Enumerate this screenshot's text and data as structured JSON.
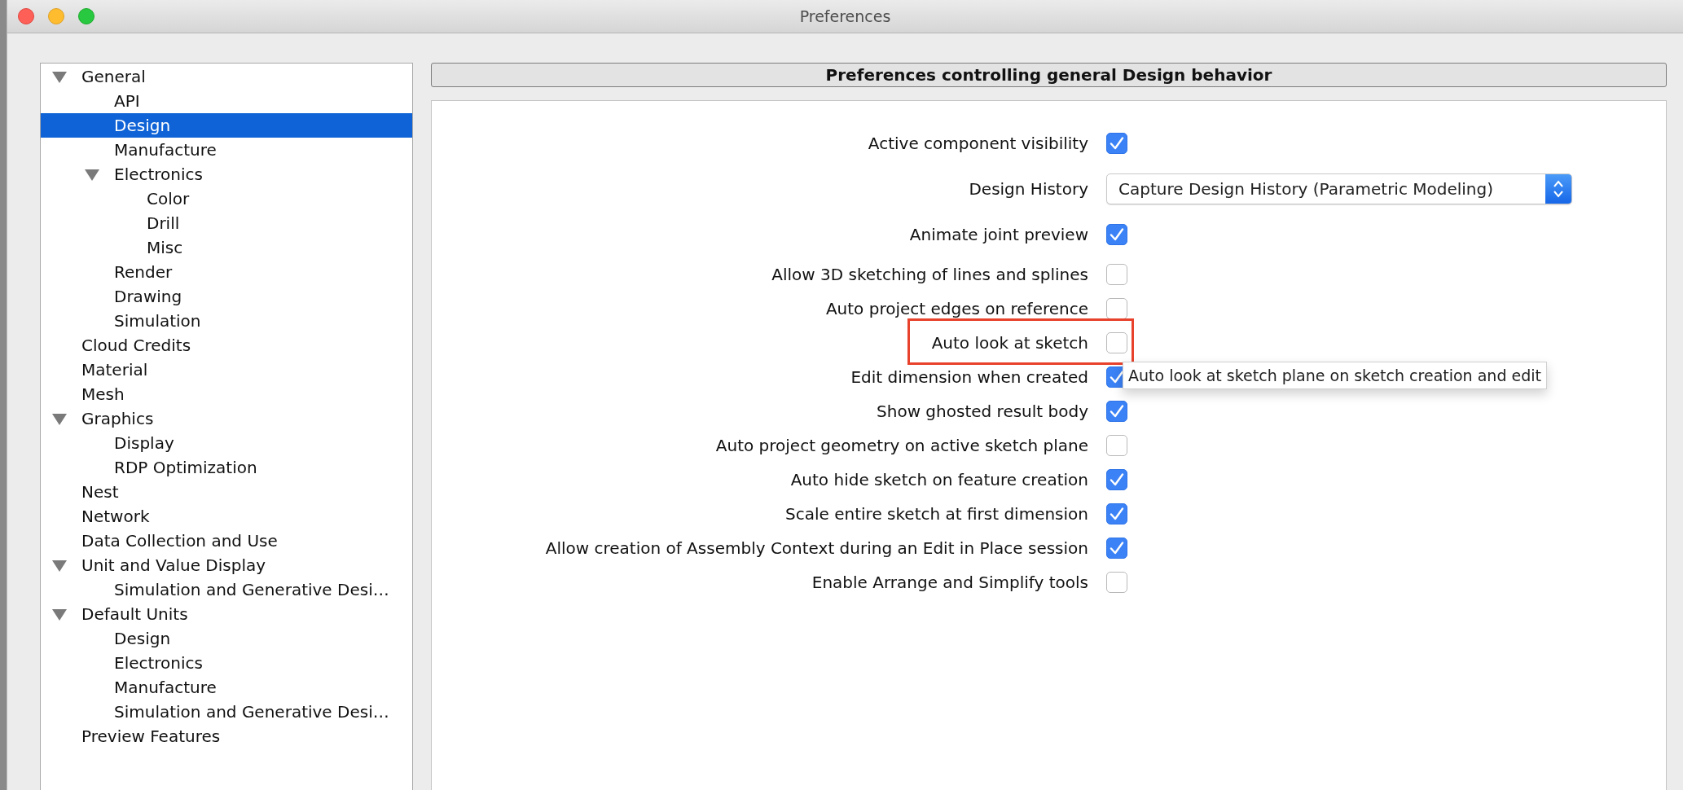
{
  "window": {
    "title": "Preferences"
  },
  "tree": [
    {
      "label": "General",
      "expanded": true,
      "selected": false,
      "children": [
        {
          "label": "API",
          "selected": false
        },
        {
          "label": "Design",
          "selected": true
        },
        {
          "label": "Manufacture",
          "selected": false
        },
        {
          "label": "Electronics",
          "expanded": true,
          "selected": false,
          "children": [
            {
              "label": "Color",
              "selected": false
            },
            {
              "label": "Drill",
              "selected": false
            },
            {
              "label": "Misc",
              "selected": false
            }
          ]
        },
        {
          "label": "Render",
          "selected": false
        },
        {
          "label": "Drawing",
          "selected": false
        },
        {
          "label": "Simulation",
          "selected": false
        }
      ]
    },
    {
      "label": "Cloud Credits",
      "selected": false
    },
    {
      "label": "Material",
      "selected": false
    },
    {
      "label": "Mesh",
      "selected": false
    },
    {
      "label": "Graphics",
      "expanded": true,
      "selected": false,
      "children": [
        {
          "label": "Display",
          "selected": false
        },
        {
          "label": "RDP Optimization",
          "selected": false
        }
      ]
    },
    {
      "label": "Nest",
      "selected": false
    },
    {
      "label": "Network",
      "selected": false
    },
    {
      "label": "Data Collection and Use",
      "selected": false
    },
    {
      "label": "Unit and Value Display",
      "expanded": true,
      "selected": false,
      "children": [
        {
          "label": "Simulation and Generative Desi…",
          "selected": false
        }
      ]
    },
    {
      "label": "Default Units",
      "expanded": true,
      "selected": false,
      "children": [
        {
          "label": "Design",
          "selected": false
        },
        {
          "label": "Electronics",
          "selected": false
        },
        {
          "label": "Manufacture",
          "selected": false
        },
        {
          "label": "Simulation and Generative Desi…",
          "selected": false
        }
      ]
    },
    {
      "label": "Preview Features",
      "selected": false
    }
  ],
  "panel": {
    "header": "Preferences controlling general Design behavior",
    "settings": [
      {
        "kind": "checkbox",
        "label": "Active component visibility",
        "checked": true,
        "highlighted": false
      },
      {
        "kind": "dropdown",
        "label": "Design History",
        "value": "Capture Design History (Parametric Modeling)"
      },
      {
        "kind": "checkbox",
        "label": "Animate joint preview",
        "checked": true,
        "highlighted": false
      },
      {
        "kind": "checkbox",
        "label": "Allow 3D sketching of lines and splines",
        "checked": false,
        "highlighted": false
      },
      {
        "kind": "checkbox",
        "label": "Auto project edges on reference",
        "checked": false,
        "highlighted": false
      },
      {
        "kind": "checkbox",
        "label": "Auto look at sketch",
        "checked": false,
        "highlighted": true,
        "tooltip": "Auto look at sketch plane on sketch creation and edit"
      },
      {
        "kind": "checkbox",
        "label": "Edit dimension when created",
        "checked": true,
        "highlighted": false
      },
      {
        "kind": "checkbox",
        "label": "Show ghosted result body",
        "checked": true,
        "highlighted": false
      },
      {
        "kind": "checkbox",
        "label": "Auto project geometry on active sketch plane",
        "checked": false,
        "highlighted": false
      },
      {
        "kind": "checkbox",
        "label": "Auto hide sketch on feature creation",
        "checked": true,
        "highlighted": false
      },
      {
        "kind": "checkbox",
        "label": "Scale entire sketch at first dimension",
        "checked": true,
        "highlighted": false
      },
      {
        "kind": "checkbox",
        "label": "Allow creation of Assembly Context during an Edit in Place session",
        "checked": true,
        "highlighted": false
      },
      {
        "kind": "checkbox",
        "label": "Enable Arrange and Simplify tools",
        "checked": false,
        "highlighted": false
      }
    ]
  }
}
